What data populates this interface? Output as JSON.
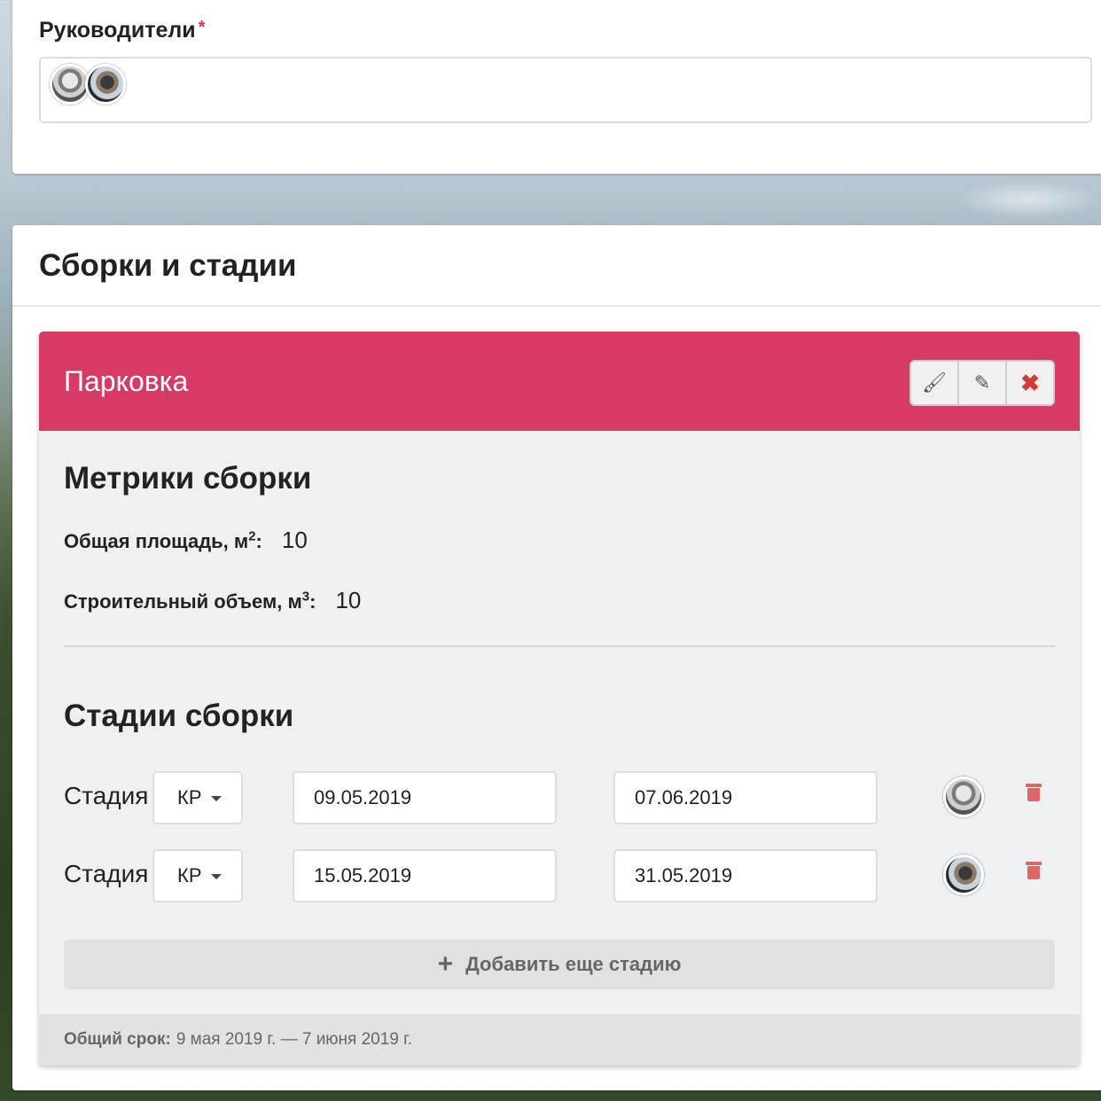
{
  "managers": {
    "label": "Руководители",
    "required_mark": "*"
  },
  "section": {
    "title": "Сборки и стадии"
  },
  "assembly": {
    "name": "Парковка",
    "header_color": "#d63a65",
    "toolbar": {
      "paint_icon": "paint-brush-icon",
      "edit_icon": "pencil-icon",
      "delete_icon": "close-icon",
      "paint_glyph": "🖌",
      "edit_glyph": "✎",
      "delete_glyph": "✖"
    },
    "metrics": {
      "title": "Метрики сборки",
      "area_label": "Общая площадь, м",
      "area_sup": "2",
      "area_suffix": ":",
      "area_value": "10",
      "volume_label": "Строительный объем, м",
      "volume_sup": "3",
      "volume_suffix": ":",
      "volume_value": "10"
    },
    "stages": {
      "title": "Стадии сборки",
      "rows": [
        {
          "label": "Стадия",
          "type": "КР",
          "start": "09.05.2019",
          "end": "07.06.2019"
        },
        {
          "label": "Стадия",
          "type": "КР",
          "start": "15.05.2019",
          "end": "31.05.2019"
        }
      ],
      "add_label": "Добавить еще стадию",
      "add_glyph": "+"
    },
    "footer": {
      "label": "Общий срок:",
      "value": "9 мая 2019 г. — 7 июня 2019 г."
    }
  }
}
